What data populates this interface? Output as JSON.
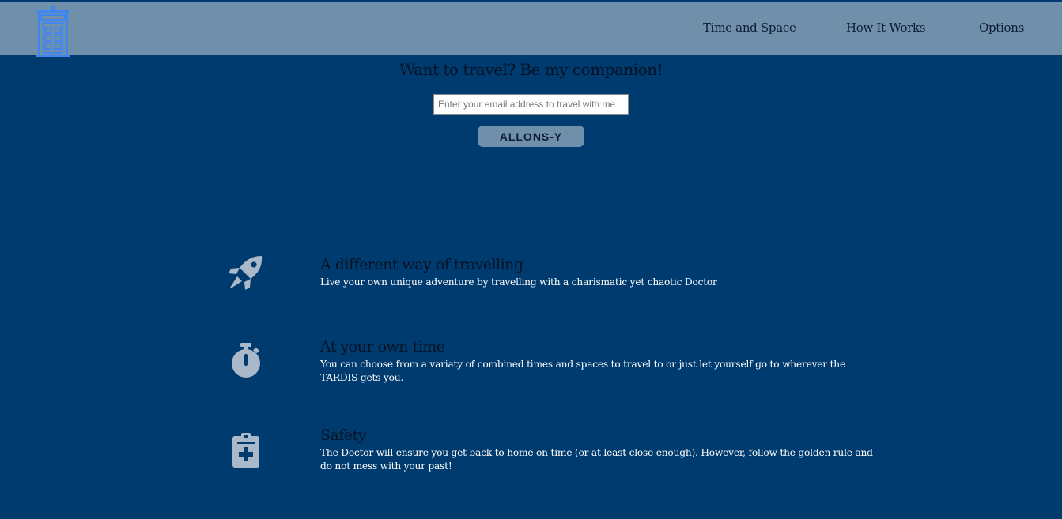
{
  "nav": {
    "logo_icon": "police-box-icon",
    "links": [
      "Time and Space",
      "How It Works",
      "Options"
    ]
  },
  "hero": {
    "headline": "Want to travel? Be my companion!",
    "email_placeholder": "Enter your email address to travel with me",
    "email_value": "",
    "button_label": "ALLONS-Y"
  },
  "features": [
    {
      "icon": "rocket-icon",
      "title": "A different way of travelling",
      "description": "Live your own unique adventure by travelling with a charismatic yet chaotic Doctor"
    },
    {
      "icon": "stopwatch-icon",
      "title": "At your own time",
      "description": "You can choose from a variaty of combined times and spaces to travel to or just let yourself go to wherever the TARDIS gets you."
    },
    {
      "icon": "clipboard-medical-icon",
      "title": "Safety",
      "description": "The Doctor will ensure you get back to home on time (or at least close enough). However, follow the golden rule and do not mess with your past!"
    }
  ],
  "colors": {
    "background": "#003b6f",
    "nav_background": "#6f8fab",
    "icon": "#a9b9c9",
    "logo": "#3f86f3",
    "button": "#6f8fab"
  }
}
